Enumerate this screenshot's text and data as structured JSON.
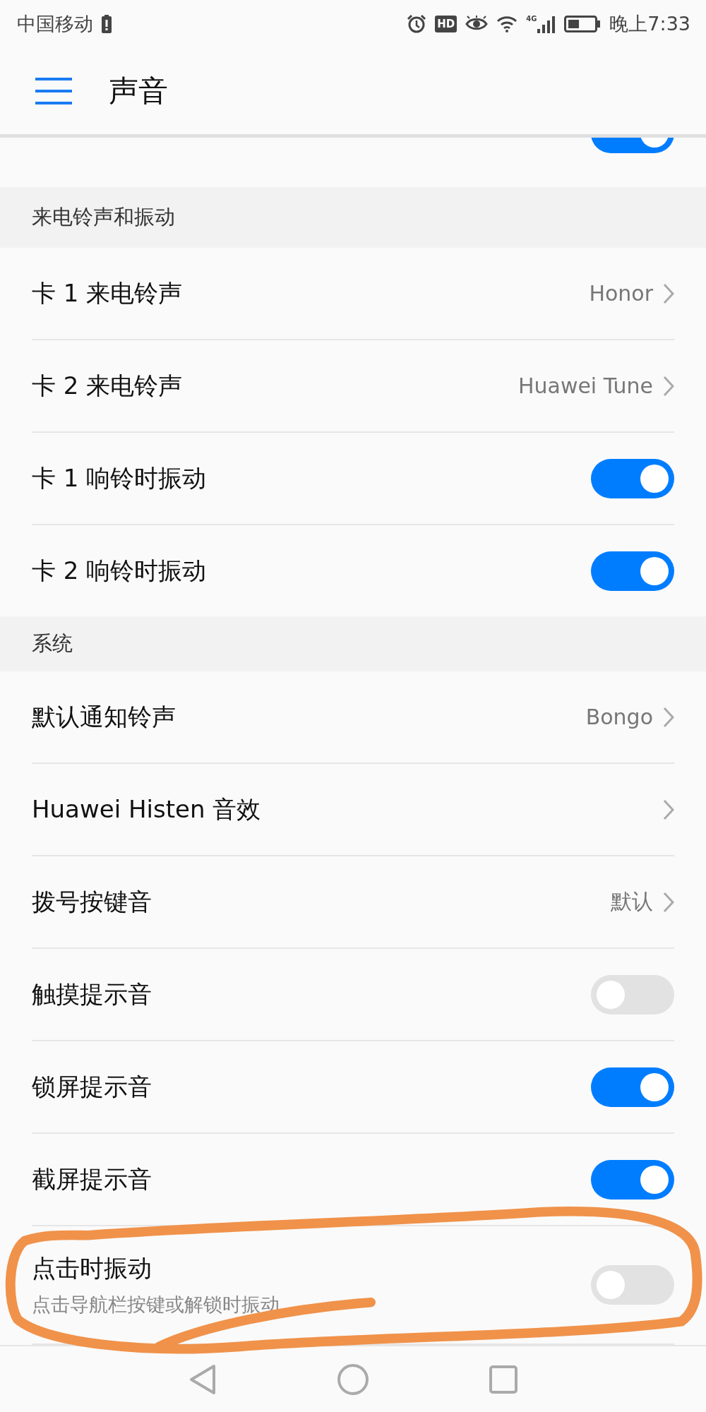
{
  "status_bar": {
    "carrier": "中国移动",
    "hd_badge": "HD",
    "network": "4G",
    "time": "晚上7:33"
  },
  "header": {
    "title": "声音"
  },
  "sections": [
    {
      "rows": [
        {
          "kind": "toggle",
          "on": true,
          "highlighted": false
        }
      ]
    },
    {
      "title": "来电铃声和振动",
      "rows": [
        {
          "kind": "link",
          "label": "卡 1 来电铃声",
          "value": "Honor",
          "highlighted": false
        },
        {
          "kind": "link",
          "label": "卡 2 来电铃声",
          "value": "Huawei Tune",
          "highlighted": false
        },
        {
          "kind": "toggle",
          "label": "卡 1 响铃时振动",
          "on": true,
          "highlighted": false
        },
        {
          "kind": "toggle",
          "label": "卡 2 响铃时振动",
          "on": true,
          "highlighted": false
        }
      ]
    },
    {
      "title": "系统",
      "rows": [
        {
          "kind": "link",
          "label": "默认通知铃声",
          "value": "Bongo",
          "highlighted": false
        },
        {
          "kind": "link",
          "label": "Huawei Histen 音效",
          "highlighted": false
        },
        {
          "kind": "link",
          "label": "拨号按键音",
          "value": "默认",
          "highlighted": false
        },
        {
          "kind": "toggle",
          "label": "触摸提示音",
          "on": false,
          "highlighted": false
        },
        {
          "kind": "toggle",
          "label": "锁屏提示音",
          "on": true,
          "highlighted": false
        },
        {
          "kind": "toggle",
          "label": "截屏提示音",
          "on": true,
          "highlighted": false
        },
        {
          "kind": "toggle",
          "label": "点击时振动",
          "subtitle": "点击导航栏按键或解锁时振动",
          "on": false,
          "highlighted": true
        }
      ]
    }
  ]
}
